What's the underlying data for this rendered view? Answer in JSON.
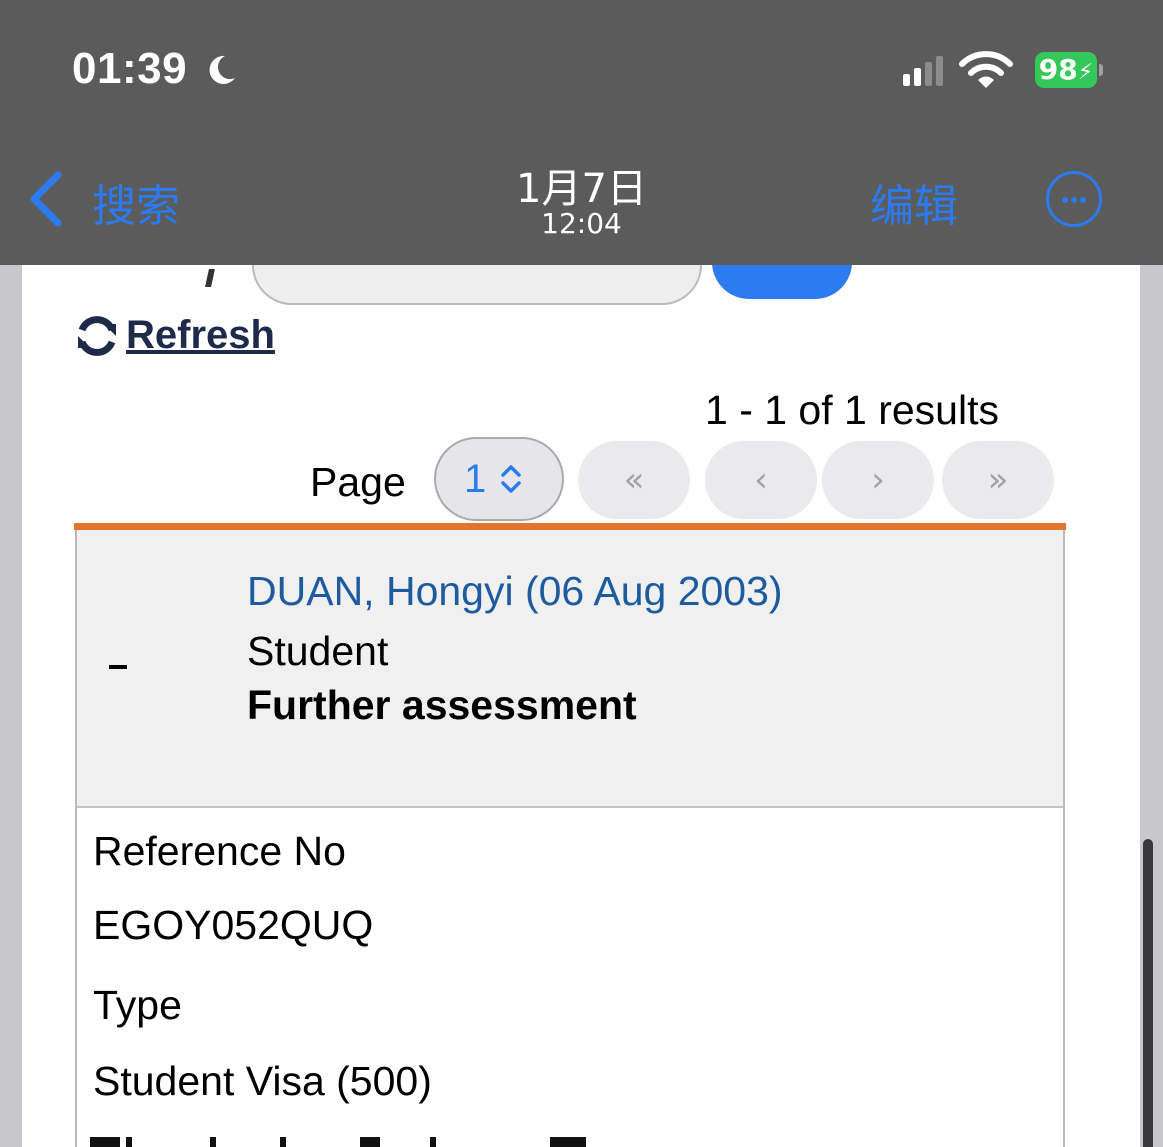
{
  "status_bar": {
    "time": "01:39",
    "battery": "98"
  },
  "nav": {
    "back_label": "搜索",
    "date": "1月7日",
    "time": "12:04",
    "edit_label": "编辑"
  },
  "toolbar": {
    "refresh_label": "Refresh",
    "results_text": "1 - 1 of 1 results",
    "page_label": "Page",
    "page_value": "1",
    "first_label": "«",
    "prev_label": "‹",
    "next_label": "›",
    "last_label": "»"
  },
  "result": {
    "name": "DUAN, Hongyi (06 Aug 2003)",
    "role": "Student",
    "status": "Further assessment",
    "fields": [
      {
        "label": "Reference No",
        "value": "EGOY052QUQ"
      },
      {
        "label": "Type",
        "value": "Student Visa (500)"
      }
    ]
  },
  "colors": {
    "accent": "#e0752e",
    "link_blue": "#2c7bf1",
    "name_blue": "#1e5b9e",
    "battery_green": "#34c759"
  }
}
